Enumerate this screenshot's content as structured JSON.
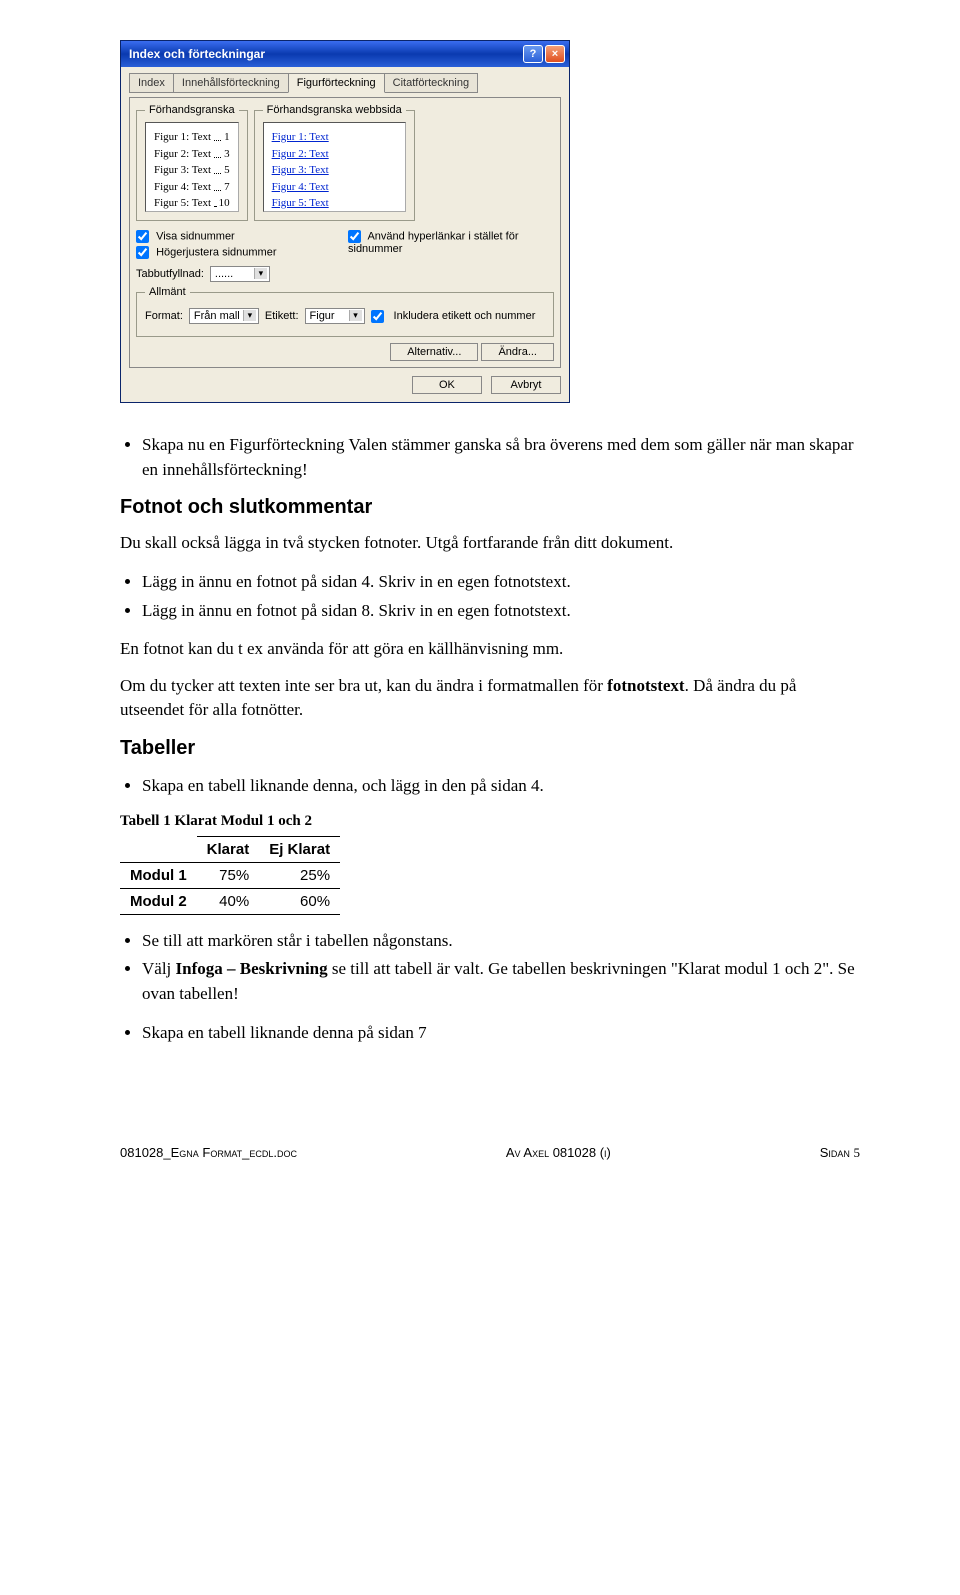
{
  "dialog": {
    "title": "Index och förteckningar",
    "tabs": [
      "Index",
      "Innehållsförteckning",
      "Figurförteckning",
      "Citatförteckning"
    ],
    "preview1_title": "Förhandsgranska",
    "preview2_title": "Förhandsgranska webbsida",
    "preview_entries": [
      {
        "label": "Figur 1: Text",
        "page": "1"
      },
      {
        "label": "Figur 2: Text",
        "page": "3"
      },
      {
        "label": "Figur 3: Text",
        "page": "5"
      },
      {
        "label": "Figur 4: Text",
        "page": "7"
      },
      {
        "label": "Figur 5: Text",
        "page": "10"
      }
    ],
    "chk_visa": "Visa sidnummer",
    "chk_hoger": "Högerjustera sidnummer",
    "chk_hyper": "Använd hyperlänkar i stället för sidnummer",
    "tabb_label": "Tabbutfyllnad:",
    "tabb_val": "......",
    "allmant": "Allmänt",
    "format_label": "Format:",
    "format_val": "Från mall",
    "etikett_label": "Etikett:",
    "etikett_val": "Figur",
    "chk_inkl": "Inkludera etikett och nummer",
    "btn_alt": "Alternativ...",
    "btn_andra": "Ändra...",
    "btn_ok": "OK",
    "btn_avbryt": "Avbryt"
  },
  "body": {
    "bullet1": "Skapa nu en Figurförteckning Valen stämmer ganska så bra överens med dem som gäller när man skapar en innehållsförteckning!",
    "h1": "Fotnot och slutkommentar",
    "p1": "Du skall också lägga in två stycken fotnoter. Utgå fortfarande från ditt dokument.",
    "bullet2": "Lägg in ännu en fotnot på sidan 4. Skriv in en egen fotnotstext.",
    "bullet3": "Lägg in ännu en fotnot på sidan 8. Skriv in en egen fotnotstext.",
    "p2": "En fotnot kan du t ex använda för att göra en källhänvisning mm.",
    "p3a": "Om du tycker att texten inte ser bra ut, kan du ändra i formatmallen för ",
    "p3b": "fotnotstext",
    "p3c": ". Då ändra du på utseendet för alla fotnötter.",
    "h2": "Tabeller",
    "bullet4": "Skapa en tabell liknande denna, och lägg in den på sidan 4.",
    "tcaption": "Tabell 1 Klarat Modul 1 och 2",
    "bullet5": "Se till att markören står i tabellen någonstans.",
    "bullet6a": "Välj ",
    "bullet6b": "Infoga – Beskrivning",
    "bullet6c": " se till att tabell är valt. Ge tabellen beskrivningen \"Klarat modul 1 och 2\". Se ovan tabellen!",
    "bullet7": "Skapa en tabell liknande denna på sidan 7"
  },
  "chart_data": {
    "type": "table",
    "columns": [
      "",
      "Klarat",
      "Ej Klarat"
    ],
    "rows": [
      {
        "label": "Modul 1",
        "klarat": "75%",
        "ej": "25%"
      },
      {
        "label": "Modul 2",
        "klarat": "40%",
        "ej": "60%"
      }
    ]
  },
  "footer": {
    "left": "081028_Egna Format_ecdl.doc",
    "mid": "Av Axel 081028 (i)",
    "right_label": "Sidan ",
    "right_num": "5"
  }
}
